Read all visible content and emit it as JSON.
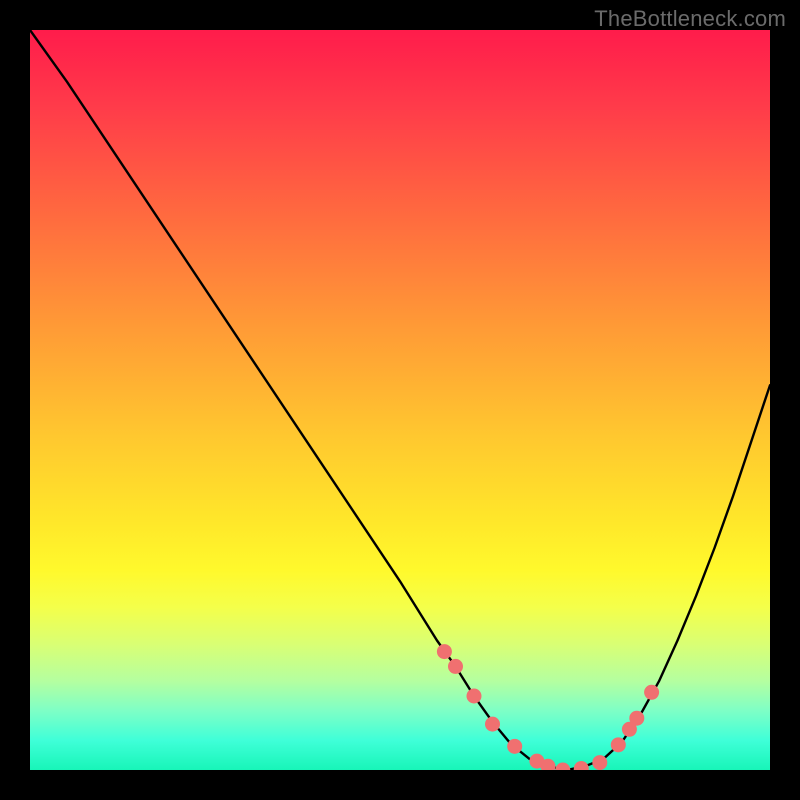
{
  "watermark": "TheBottleneck.com",
  "chart_data": {
    "type": "line",
    "title": "",
    "xlabel": "",
    "ylabel": "",
    "xlim": [
      0,
      1
    ],
    "ylim": [
      0,
      1
    ],
    "series": [
      {
        "name": "curve",
        "x": [
          0.0,
          0.05,
          0.1,
          0.15,
          0.2,
          0.25,
          0.3,
          0.35,
          0.4,
          0.45,
          0.5,
          0.55,
          0.575,
          0.6,
          0.625,
          0.65,
          0.675,
          0.7,
          0.725,
          0.75,
          0.775,
          0.8,
          0.825,
          0.85,
          0.875,
          0.9,
          0.925,
          0.95,
          0.975,
          1.0
        ],
        "y": [
          1.0,
          0.93,
          0.855,
          0.78,
          0.705,
          0.63,
          0.555,
          0.48,
          0.405,
          0.33,
          0.255,
          0.175,
          0.14,
          0.1,
          0.065,
          0.035,
          0.015,
          0.005,
          0.0,
          0.005,
          0.015,
          0.038,
          0.075,
          0.12,
          0.175,
          0.235,
          0.3,
          0.37,
          0.445,
          0.52
        ]
      }
    ],
    "markers": {
      "name": "highlight-points",
      "x": [
        0.56,
        0.575,
        0.6,
        0.625,
        0.655,
        0.685,
        0.7,
        0.72,
        0.745,
        0.77,
        0.795,
        0.81,
        0.82,
        0.84
      ],
      "y": [
        0.16,
        0.14,
        0.1,
        0.062,
        0.032,
        0.012,
        0.005,
        0.0,
        0.002,
        0.01,
        0.034,
        0.055,
        0.07,
        0.105
      ]
    },
    "marker_color": "#f07070",
    "curve_color": "#000000"
  }
}
